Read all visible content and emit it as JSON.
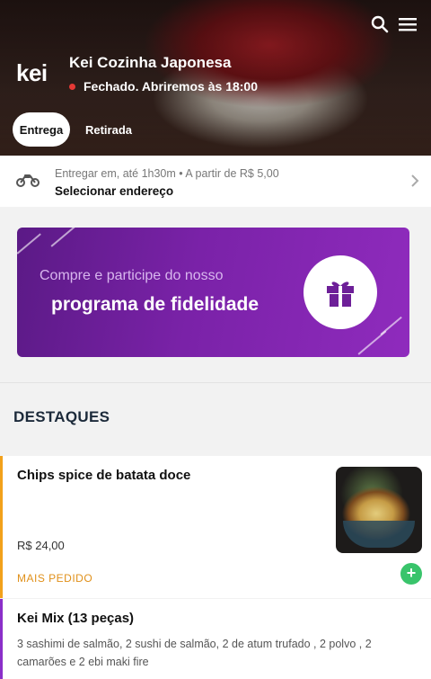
{
  "header": {
    "logo_text": "kei",
    "store_name": "Kei Cozinha Japonesa",
    "status_text": "Fechado. Abriremos às 18:00",
    "tabs": [
      {
        "label": "Entrega",
        "active": true
      },
      {
        "label": "Retirada",
        "active": false
      }
    ],
    "icons": [
      "search-icon",
      "menu-icon"
    ]
  },
  "delivery": {
    "info": "Entregar em, até 1h30m  •  A partir de R$ 5,00",
    "action": "Selecionar endereço",
    "icon": "motorcycle-icon"
  },
  "banner": {
    "subtitle": "Compre e participe do nosso",
    "title": "programa de fidelidade",
    "icon": "gift-icon"
  },
  "section": {
    "title": "DESTAQUES"
  },
  "items": [
    {
      "name": "Chips spice de batata doce",
      "price": "R$ 24,00",
      "badge": "MAIS PEDIDO",
      "accent": "#f2a11b"
    },
    {
      "name": "Kei Mix (13 peças)",
      "description": "3 sashimi de salmão, 2 sushi de salmão, 2 de atum trufado , 2 polvo , 2 camarões e 2 ebi maki fire",
      "accent": "#8b2fc9"
    }
  ],
  "colors": {
    "status_closed": "#e53935",
    "banner_purple": "#7a22a8",
    "add_button": "#39c46b"
  }
}
